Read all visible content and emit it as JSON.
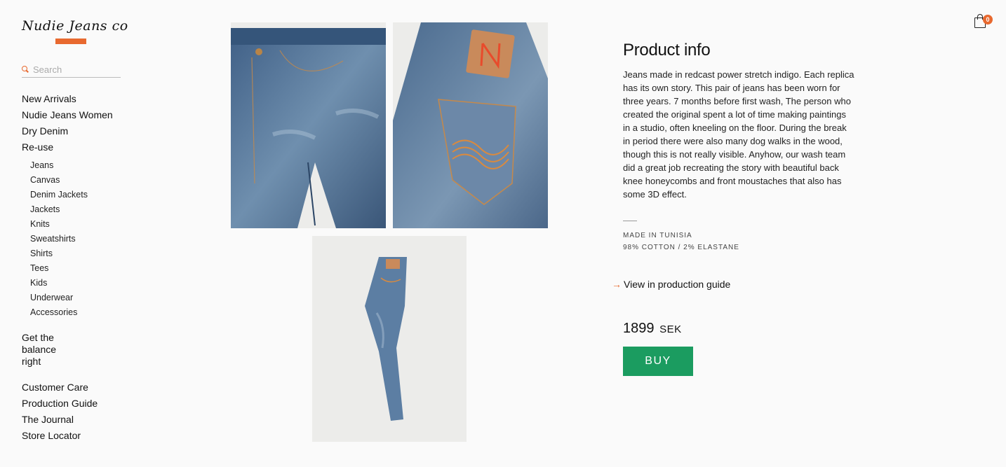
{
  "brand": {
    "logo_text": "Nudie Jeans co",
    "accent_color": "#e8692f"
  },
  "search": {
    "placeholder": "Search",
    "value": ""
  },
  "nav": {
    "main": [
      "New Arrivals",
      "Nudie Jeans Women",
      "Dry Denim",
      "Re-use"
    ],
    "sub": [
      "Jeans",
      "Canvas",
      "Denim Jackets",
      "Jackets",
      "Knits",
      "Sweatshirts",
      "Shirts",
      "Tees",
      "Kids",
      "Underwear",
      "Accessories"
    ],
    "balance": "Get the balance right",
    "footer": [
      "Customer Care",
      "Production Guide",
      "The Journal",
      "Store Locator"
    ]
  },
  "images": {
    "front": "jeans-front-photo",
    "back": "jeans-back-pocket-photo",
    "side": "jeans-side-photo"
  },
  "product": {
    "heading": "Product info",
    "description": "Jeans made in redcast power stretch indigo. Each replica has its own story. This pair of jeans has been worn for three years. 7 months before first wash, The person who created the original spent a lot of time making paintings in a studio, often kneeling on the floor. During the break in period there were also many dog walks in the wood, though this is not really visible. Anyhow, our wash team did a great job recreating the story with beautiful back knee honeycombs and front moustaches that also has some 3D effect.",
    "made_in": "MADE IN TUNISIA",
    "composition": "98% COTTON / 2% ELASTANE",
    "guide_link": "View in production guide",
    "price": "1899",
    "currency": "SEK",
    "buy_label": "BUY",
    "buy_color": "#1b9c60"
  },
  "cart": {
    "count": "0",
    "icon": "shopping-bag-icon"
  }
}
